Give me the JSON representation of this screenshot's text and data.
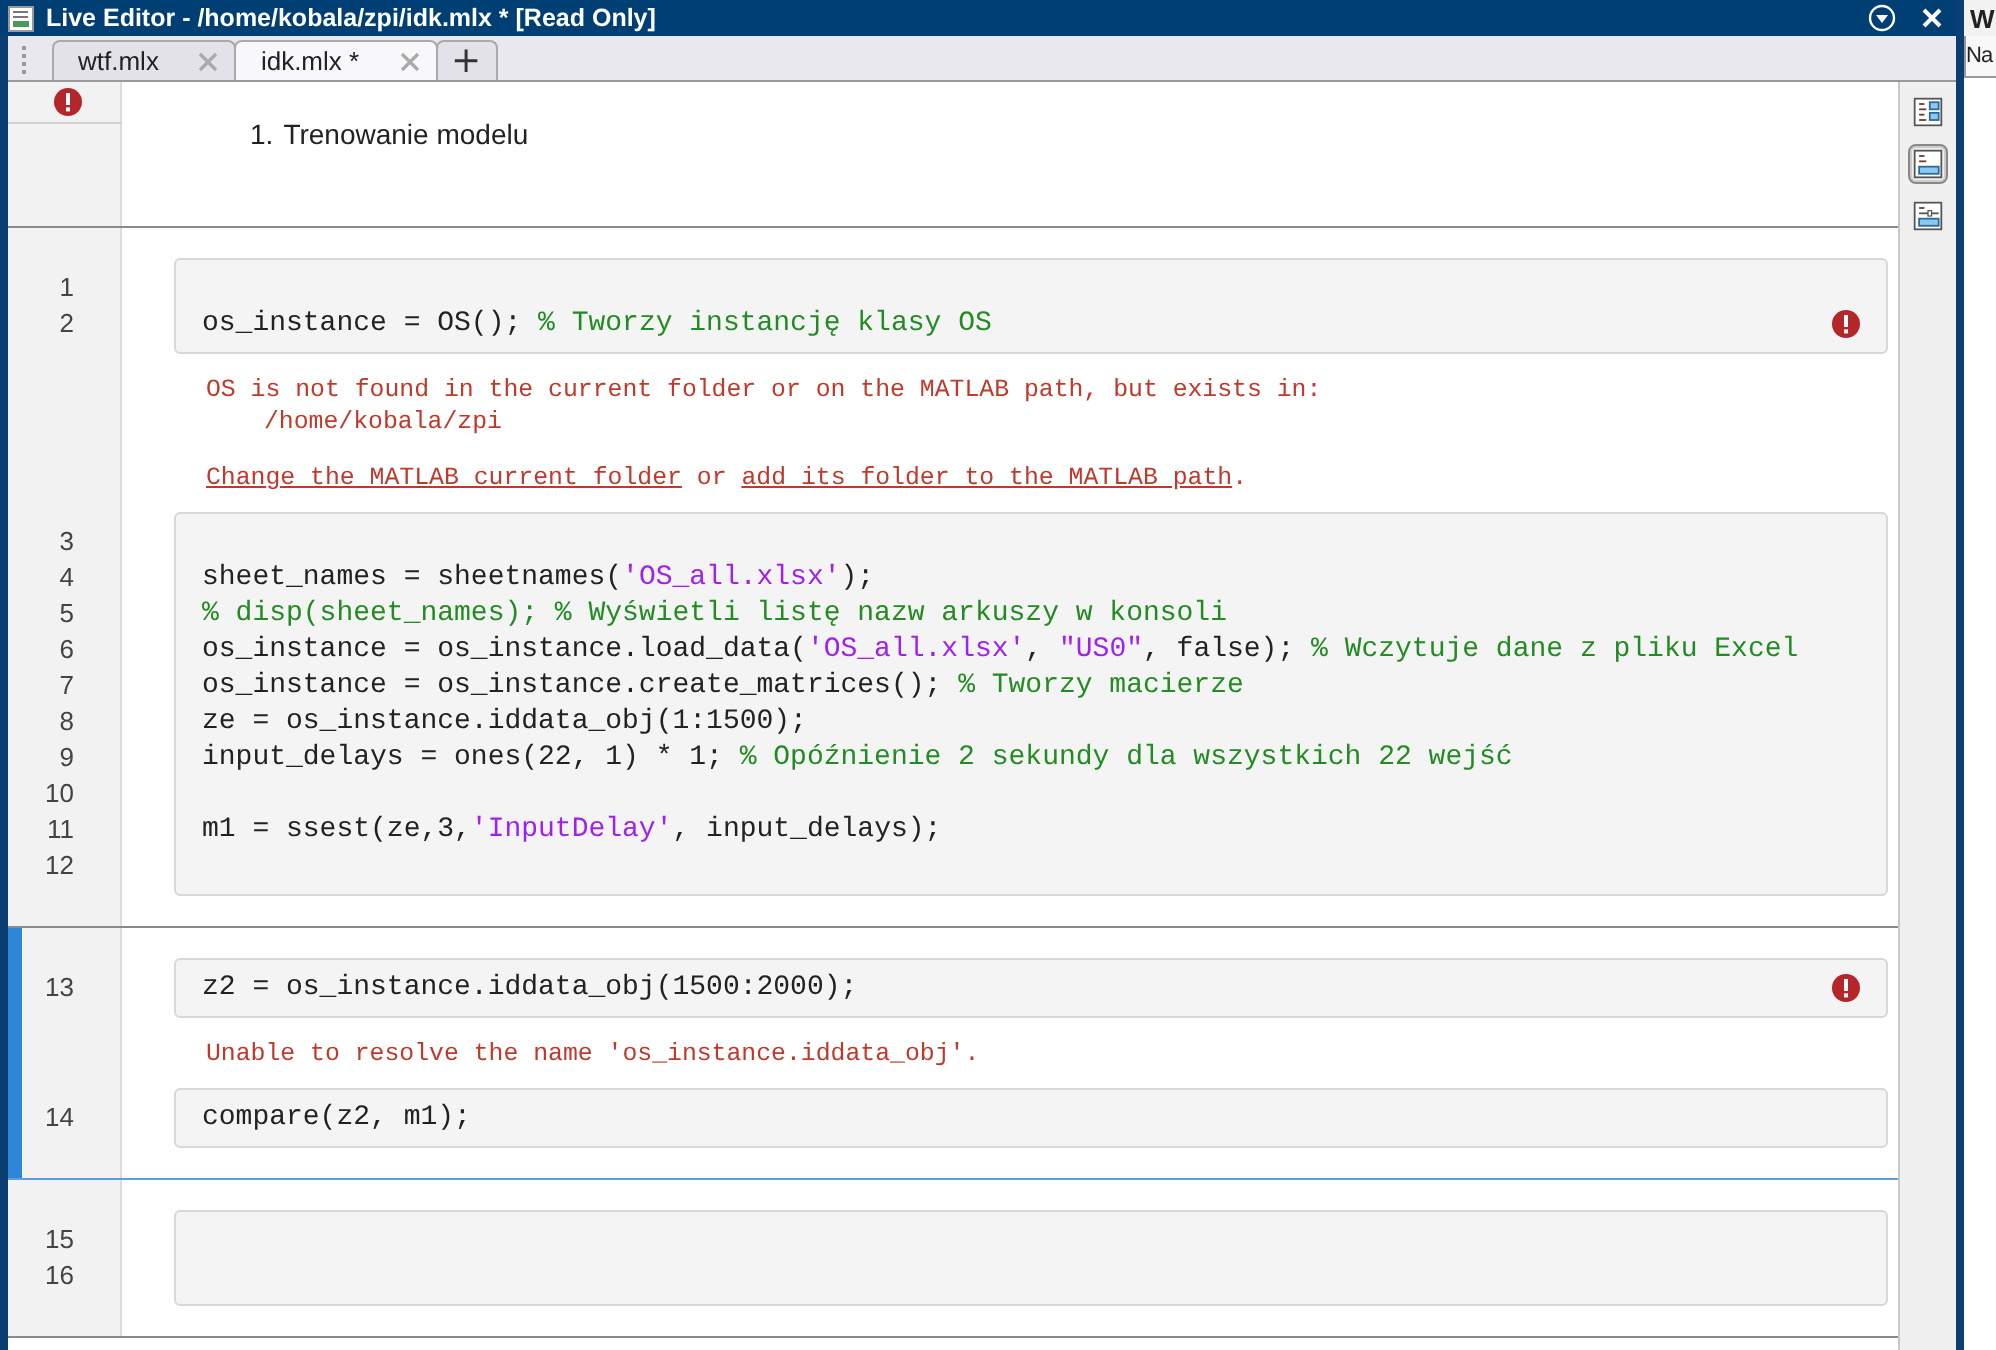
{
  "window": {
    "title": "Live Editor - /home/kobala/zpi/idk.mlx * [Read Only]"
  },
  "tabs": [
    {
      "label": "wtf.mlx",
      "selected": false
    },
    {
      "label": "idk.mlx *",
      "selected": true
    }
  ],
  "new_tab_label": "+",
  "sections": [
    {
      "kind": "text",
      "selected": false,
      "has_error": true,
      "number": "1.",
      "text": "Trenowanie modelu"
    },
    {
      "kind": "code",
      "selected": false,
      "blocks": [
        {
          "kind": "code",
          "error": true,
          "lines": [
            {
              "number": "1"
            },
            {
              "number": "2",
              "segments": [
                {
                  "kind": "code",
                  "text": "os_instance = OS(); "
                },
                {
                  "kind": "comment",
                  "text": "% Tworzy instancję klasy OS"
                }
              ]
            }
          ]
        },
        {
          "kind": "message",
          "paragraphs": [
            {
              "lines": [
                {
                  "indent": false,
                  "segments": [
                    {
                      "kind": "text",
                      "text": "OS is not found in the current folder or on the MATLAB path, but exists in:"
                    }
                  ]
                },
                {
                  "indent": true,
                  "segments": [
                    {
                      "kind": "text",
                      "text": "/home/kobala/zpi"
                    }
                  ]
                }
              ]
            },
            {
              "lines": [
                {
                  "indent": false,
                  "segments": [
                    {
                      "kind": "link",
                      "text": "Change the MATLAB current folder"
                    },
                    {
                      "kind": "text",
                      "text": " or "
                    },
                    {
                      "kind": "link",
                      "text": "add its folder to the MATLAB path"
                    },
                    {
                      "kind": "text",
                      "text": "."
                    }
                  ]
                }
              ]
            }
          ]
        },
        {
          "kind": "code",
          "error": false,
          "lines": [
            {
              "number": "3"
            },
            {
              "number": "4",
              "segments": [
                {
                  "kind": "code",
                  "text": "sheet_names = sheetnames("
                },
                {
                  "kind": "string",
                  "text": "'OS_all.xlsx'"
                },
                {
                  "kind": "code",
                  "text": ");"
                }
              ]
            },
            {
              "number": "5",
              "segments": [
                {
                  "kind": "comment",
                  "text": "% disp(sheet_names); % Wyświetli listę nazw arkuszy w konsoli"
                }
              ]
            },
            {
              "number": "6",
              "segments": [
                {
                  "kind": "code",
                  "text": "os_instance = os_instance.load_data("
                },
                {
                  "kind": "string",
                  "text": "'OS_all.xlsx'"
                },
                {
                  "kind": "code",
                  "text": ", "
                },
                {
                  "kind": "string",
                  "text": "\"US0\""
                },
                {
                  "kind": "code",
                  "text": ", false); "
                },
                {
                  "kind": "comment",
                  "text": "% Wczytuje dane z pliku Excel"
                }
              ]
            },
            {
              "number": "7",
              "segments": [
                {
                  "kind": "code",
                  "text": "os_instance = os_instance.create_matrices(); "
                },
                {
                  "kind": "comment",
                  "text": "% Tworzy macierze"
                }
              ]
            },
            {
              "number": "8",
              "segments": [
                {
                  "kind": "code",
                  "text": "ze = os_instance.iddata_obj(1:1500);"
                }
              ]
            },
            {
              "number": "9",
              "segments": [
                {
                  "kind": "code",
                  "text": "input_delays = ones(22, 1) * 1; "
                },
                {
                  "kind": "comment",
                  "text": "% Opóźnienie 2 sekundy dla wszystkich 22 wejść"
                }
              ]
            },
            {
              "number": "10"
            },
            {
              "number": "11",
              "segments": [
                {
                  "kind": "code",
                  "text": "m1 = ssest(ze,3,"
                },
                {
                  "kind": "string",
                  "text": "'InputDelay'"
                },
                {
                  "kind": "code",
                  "text": ", input_delays);"
                }
              ]
            },
            {
              "number": "12"
            }
          ]
        }
      ]
    },
    {
      "kind": "code",
      "selected": true,
      "blocks": [
        {
          "kind": "code",
          "error": true,
          "lines": [
            {
              "number": "13",
              "segments": [
                {
                  "kind": "code",
                  "text": "z2 = os_instance.iddata_obj(1500:2000);"
                }
              ]
            }
          ]
        },
        {
          "kind": "message",
          "paragraphs": [
            {
              "lines": [
                {
                  "indent": false,
                  "segments": [
                    {
                      "kind": "text",
                      "text": "Unable to resolve the name 'os_instance.iddata_obj'."
                    }
                  ]
                }
              ]
            }
          ]
        },
        {
          "kind": "code",
          "error": false,
          "lines": [
            {
              "number": "14",
              "segments": [
                {
                  "kind": "code",
                  "text": "compare(z2, m1);"
                }
              ]
            }
          ]
        }
      ]
    },
    {
      "kind": "code",
      "selected": false,
      "blocks": [
        {
          "kind": "code",
          "error": false,
          "lines": [
            {
              "number": "15"
            },
            {
              "number": "16"
            }
          ]
        }
      ]
    }
  ],
  "view_modes": [
    {
      "kind": "output-right",
      "selected": false
    },
    {
      "kind": "output-inline",
      "selected": true
    },
    {
      "kind": "hide-code",
      "selected": false
    }
  ],
  "side_panel": {
    "title": "W",
    "column_header": "Na"
  }
}
